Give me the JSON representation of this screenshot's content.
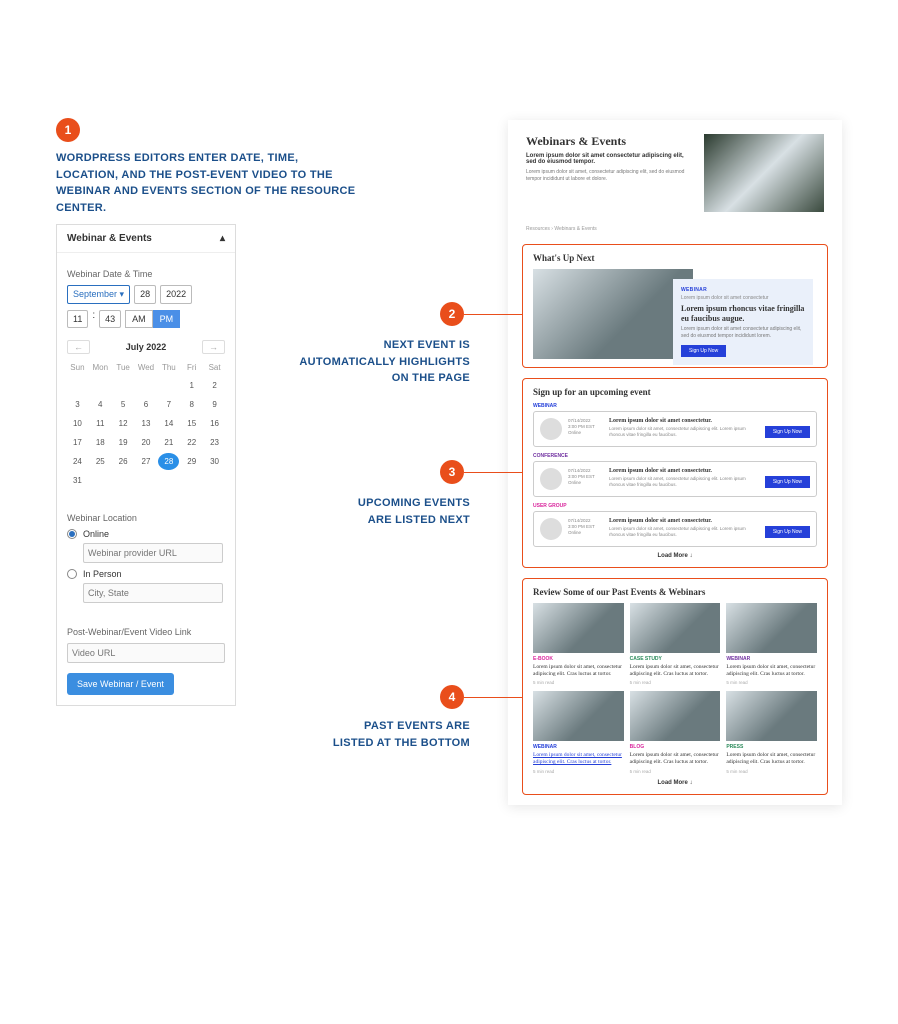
{
  "badges": [
    "1",
    "2",
    "3",
    "4"
  ],
  "captions": {
    "c1": "WORDPRESS EDITORS ENTER DATE, TIME, LOCATION, AND THE POST-EVENT VIDEO TO THE WEBINAR AND EVENTS SECTION OF THE RESOURCE CENTER.",
    "c2": "NEXT EVENT IS AUTOMATICALLY HIGHLIGHTS ON THE PAGE",
    "c3": "UPCOMING EVENTS ARE LISTED NEXT",
    "c4": "PAST EVENTS ARE LISTED AT THE BOTTOM"
  },
  "editor": {
    "title": "Webinar & Events",
    "section_date": "Webinar Date & Time",
    "month": "September",
    "day": "28",
    "year": "2022",
    "hour": "11",
    "colon": ":",
    "min": "43",
    "am": "AM",
    "pm": "PM",
    "cal_month": "July 2022",
    "dows": [
      "Sun",
      "Mon",
      "Tue",
      "Wed",
      "Thu",
      "Fri",
      "Sat"
    ],
    "prev": "←",
    "next": "→",
    "selected_day": "28",
    "section_loc": "Webinar Location",
    "opt_online": "Online",
    "ph_online": "Webinar provider URL",
    "opt_person": "In Person",
    "ph_person": "City, State",
    "section_video": "Post-Webinar/Event Video Link",
    "ph_video": "Video URL",
    "save": "Save Webinar / Event"
  },
  "page": {
    "hero_title": "Webinars & Events",
    "hero_sub": "Lorem ipsum dolor sit amet consectetur adipiscing elit, sed do eiusmod tempor.",
    "hero_txt": "Lorem ipsum dolor sit amet, consectetur adipiscing elit, sed do eiusmod tempor incididunt ut labore et dolore.",
    "crumb": "Resources  ›  Webinars & Events",
    "next_h": "What's Up Next",
    "next_cat": "WEBINAR",
    "next_sub": "Lorem ipsum dolor sit amet consectetur",
    "next_title": "Lorem ipsum rhoncus vitae fringilla eu faucibus augue.",
    "next_p": "Lorem ipsum dolor sit amet consectetur adipiscing elit, sed do eiusmod tempor incididunt lorem.",
    "signup": "Sign Up Now",
    "upcoming_h": "Sign up for an upcoming event",
    "ev_title": "Lorem ipsum dolor sit amet consectetur.",
    "ev_p": "Lorem ipsum dolor sit amet, consectetur adipiscing elit. Lorem ipsum rhoncus vitae fringilla eu faucibus.",
    "ev1_cat": "WEBINAR",
    "ev2_cat": "CONFERENCE",
    "ev3_cat": "USER GROUP",
    "meta1": "07/14/2022",
    "meta2": "3:00 PM EST",
    "meta3": "Online",
    "load_more": "Load More ↓",
    "past_h": "Review Some of our Past Events & Webinars",
    "card_title": "Lorem ipsum dolor sit amet, consectetur adipiscing elit. Cras luctus at tortor.",
    "card_meta": "5 min read",
    "pc1": "E-BOOK",
    "pc2": "CASE STUDY",
    "pc3": "WEBINAR",
    "pc4": "WEBINAR",
    "pc5": "BLOG",
    "pc6": "PRESS"
  },
  "cal_days": [
    "",
    "",
    "",
    "",
    "",
    "1",
    "2",
    "3",
    "4",
    "5",
    "6",
    "7",
    "8",
    "9",
    "10",
    "11",
    "12",
    "13",
    "14",
    "15",
    "16",
    "17",
    "18",
    "19",
    "20",
    "21",
    "22",
    "23",
    "24",
    "25",
    "26",
    "27",
    "28",
    "29",
    "30",
    "31"
  ]
}
